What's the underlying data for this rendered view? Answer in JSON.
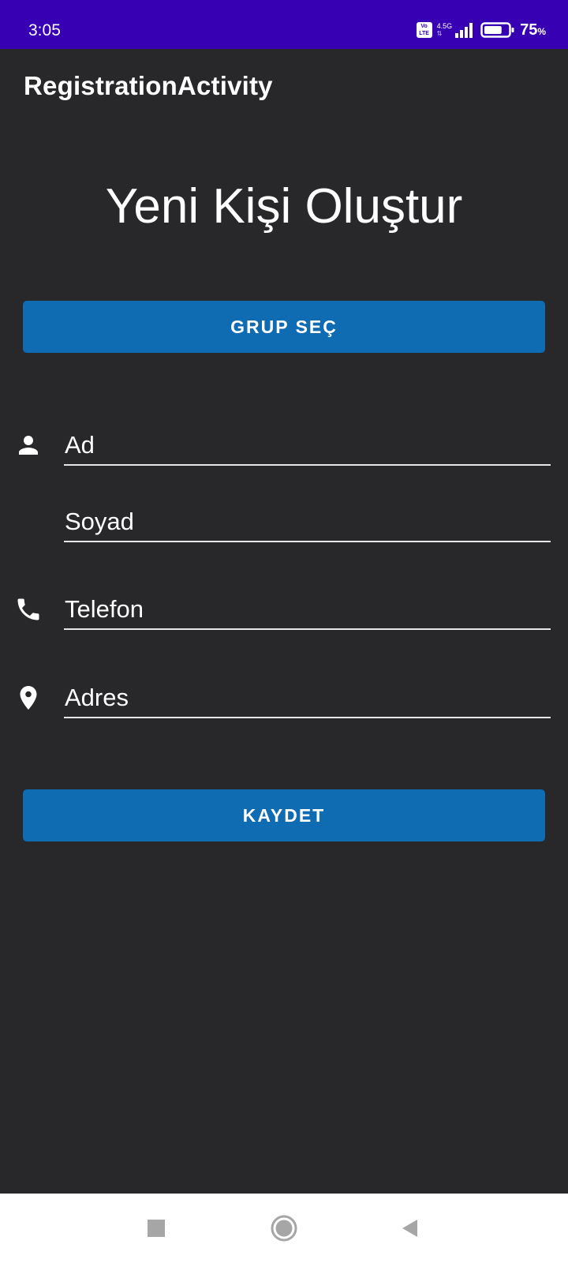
{
  "status_bar": {
    "time": "3:05",
    "volte_top": "Vo",
    "volte_bottom": "LTE",
    "network": "4.5G",
    "battery_percent": "75",
    "battery_unit": "%",
    "battery_level": 0.75,
    "background_color": "#3700b3"
  },
  "app_bar": {
    "title": "RegistrationActivity"
  },
  "form": {
    "heading": "Yeni Kişi Oluştur",
    "group_button_label": "GRUP SEÇ",
    "fields": {
      "first_name": {
        "placeholder": "Ad",
        "icon": "person-icon"
      },
      "last_name": {
        "placeholder": "Soyad"
      },
      "phone": {
        "placeholder": "Telefon",
        "icon": "phone-icon"
      },
      "address": {
        "placeholder": "Adres",
        "icon": "location-pin-icon"
      }
    },
    "save_button_label": "KAYDET"
  },
  "colors": {
    "background": "#28282a",
    "button": "#0f6bb2",
    "text": "#ffffff",
    "nav_bar": "#ffffff",
    "nav_icons": "#a6a6a6"
  },
  "nav_bar": {
    "icons": [
      "recent-apps-icon",
      "home-icon",
      "back-icon"
    ]
  }
}
